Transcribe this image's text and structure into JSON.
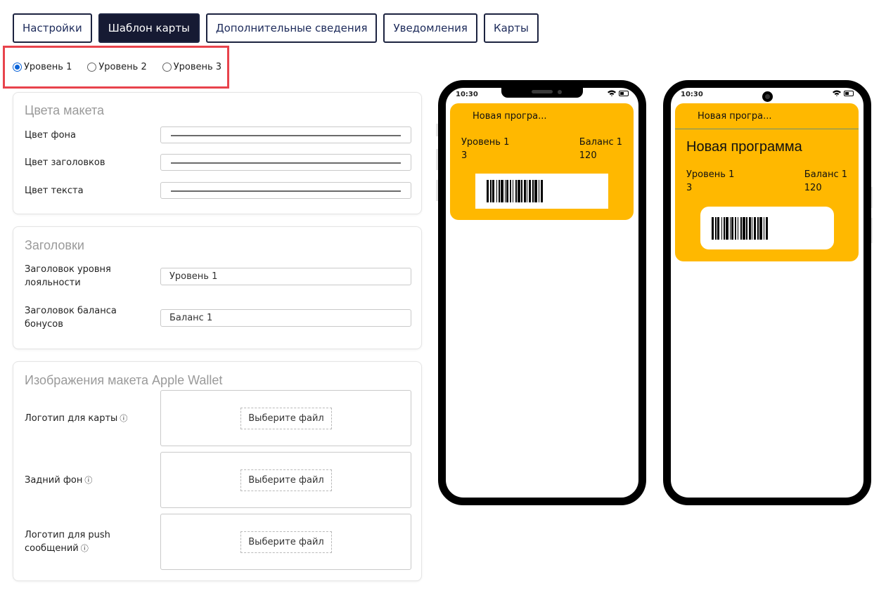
{
  "tabs": [
    {
      "label": "Настройки",
      "active": false
    },
    {
      "label": "Шаблон карты",
      "active": true
    },
    {
      "label": "Дополнительные сведения",
      "active": false
    },
    {
      "label": "Уведомления",
      "active": false
    },
    {
      "label": "Карты",
      "active": false
    }
  ],
  "levels": {
    "options": [
      "Уровень 1",
      "Уровень 2",
      "Уровень 3"
    ],
    "selected": "Уровень 1"
  },
  "colors_section": {
    "title": "Цвета макета",
    "background_label": "Цвет фона",
    "headers_label": "Цвет заголовков",
    "text_label": "Цвет текста"
  },
  "headers_section": {
    "title": "Заголовки",
    "loyalty_label": "Заголовок уровня лояльности",
    "loyalty_value": "Уровень 1",
    "balance_label": "Заголовок баланса бонусов",
    "balance_value": "Баланс 1"
  },
  "images_section": {
    "title": "Изображения макета Apple Wallet",
    "logo_label": "Логотип для карты",
    "background_label": "Задний фон",
    "push_logo_label": "Логотип для push сообщений",
    "info_icon": "ⓘ",
    "choose_file": "Выберите файл"
  },
  "preview": {
    "time": "10:30",
    "card_color": "#ffb800",
    "program_short": "Новая програ...",
    "program_full": "Новая программа",
    "level_label": "Уровень 1",
    "level_value": "3",
    "balance_label": "Баланс 1",
    "balance_value": "120"
  },
  "accent_colors": {
    "tab_active_bg": "#161a33",
    "highlight_border": "#e8434c",
    "radio": "#0a63d8"
  }
}
